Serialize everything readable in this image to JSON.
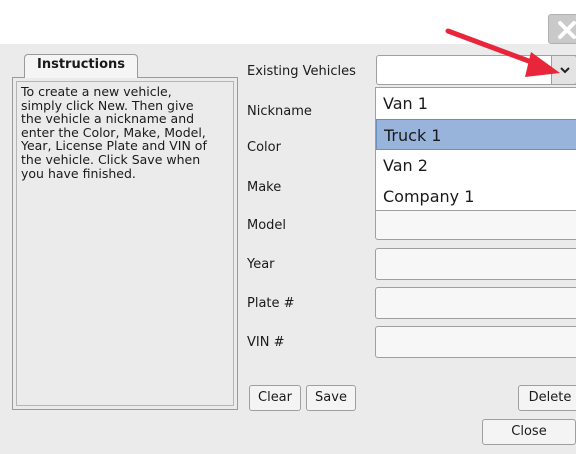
{
  "window": {
    "close_icon": "close-x-icon"
  },
  "instructions": {
    "tab_label": "Instructions",
    "text": "To create a new vehicle,\nsimply click New. Then give\nthe vehicle a nickname and\nenter the Color, Make, Model,\nYear, License Plate and VIN of\nthe vehicle. Click Save when\nyou have finished."
  },
  "form": {
    "existing_label": "Existing Vehicles",
    "existing_value": "",
    "nickname_label": "Nickname",
    "color_label": "Color",
    "make_label": "Make",
    "model_label": "Model",
    "year_label": "Year",
    "plate_label": "Plate #",
    "vin_label": "VIN #"
  },
  "dropdown": {
    "options": [
      "Van 1",
      "Truck 1",
      "Van 2",
      "Company 1"
    ],
    "selected_index": 1
  },
  "buttons": {
    "clear": "Clear",
    "save": "Save",
    "delete": "Delete",
    "close": "Close"
  },
  "annotation": {
    "arrow_color": "#e8253b"
  }
}
